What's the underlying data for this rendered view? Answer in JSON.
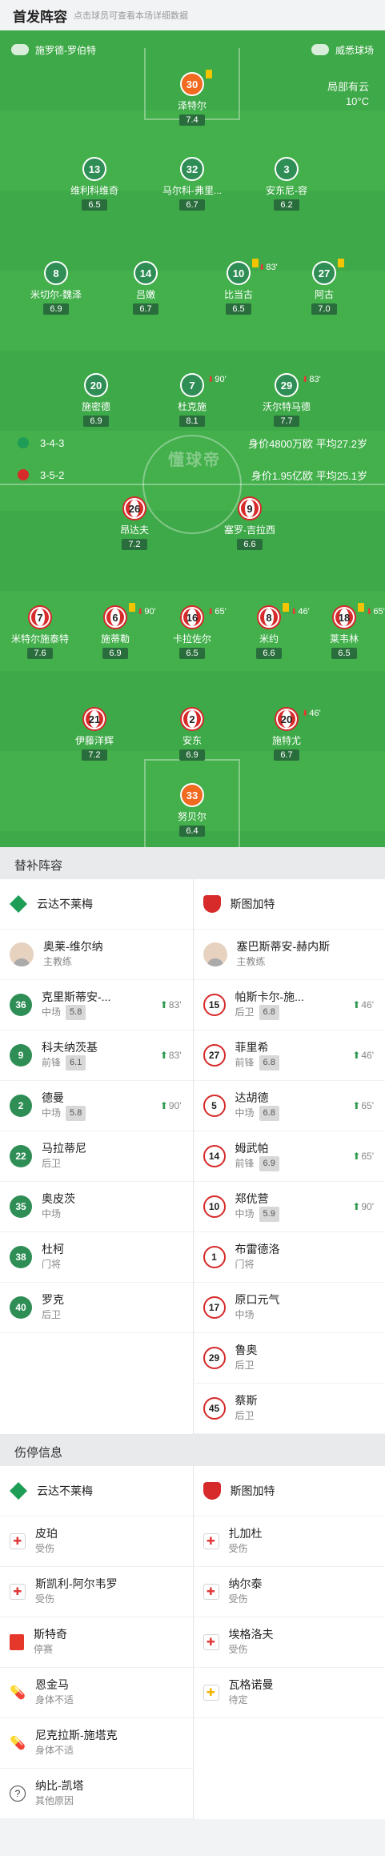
{
  "header": {
    "title": "首发阵容",
    "subtitle": "点击球员可查看本场详细数据"
  },
  "pitch_top": {
    "home_coach": "施罗德-罗伯特",
    "stadium": "威悉球场",
    "weather": "局部有云",
    "temp": "10°C",
    "watermark": "懂球帝"
  },
  "home_formation": {
    "formation": "3-4-3",
    "value": "身价4800万欧",
    "age": "平均27.2岁"
  },
  "away_formation": {
    "formation": "3-5-2",
    "value": "身价1.95亿欧",
    "age": "平均25.1岁"
  },
  "players": [
    {
      "num": "30",
      "name": "泽特尔",
      "rating": "7.4"
    },
    {
      "num": "13",
      "name": "维利科维奇",
      "rating": "6.5"
    },
    {
      "num": "32",
      "name": "马尔科-弗里...",
      "rating": "6.7"
    },
    {
      "num": "3",
      "name": "安东尼-容",
      "rating": "6.2"
    },
    {
      "num": "8",
      "name": "米切尔-魏泽",
      "rating": "6.9"
    },
    {
      "num": "14",
      "name": "吕嫩",
      "rating": "6.7"
    },
    {
      "num": "10",
      "name": "比当古",
      "rating": "6.5",
      "sub": "83'"
    },
    {
      "num": "27",
      "name": "阿古",
      "rating": "7.0"
    },
    {
      "num": "20",
      "name": "施密德",
      "rating": "6.9"
    },
    {
      "num": "7",
      "name": "杜克施",
      "rating": "8.1",
      "sub": "90'"
    },
    {
      "num": "29",
      "name": "沃尔特马德",
      "rating": "7.7",
      "sub": "83'"
    },
    {
      "num": "26",
      "name": "昂达夫",
      "rating": "7.2"
    },
    {
      "num": "9",
      "name": "塞罗-吉拉西",
      "rating": "6.6"
    },
    {
      "num": "7",
      "name": "米特尔施泰特",
      "rating": "7.6"
    },
    {
      "num": "6",
      "name": "施蒂勒",
      "rating": "6.9",
      "sub": "90'"
    },
    {
      "num": "16",
      "name": "卡拉佐尔",
      "rating": "6.5",
      "sub": "65'"
    },
    {
      "num": "8",
      "name": "米约",
      "rating": "6.6",
      "sub": "46'"
    },
    {
      "num": "18",
      "name": "莱韦林",
      "rating": "6.5",
      "sub": "65'"
    },
    {
      "num": "21",
      "name": "伊藤洋辉",
      "rating": "7.2"
    },
    {
      "num": "2",
      "name": "安东",
      "rating": "6.9"
    },
    {
      "num": "20",
      "name": "施特尤",
      "rating": "6.7",
      "sub": "46'"
    },
    {
      "num": "33",
      "name": "努贝尔",
      "rating": "6.4"
    }
  ],
  "subs": {
    "title": "替补阵容",
    "home_team": "云达不莱梅",
    "away_team": "斯图加特",
    "home_coach": {
      "name": "奥莱-维尔纳",
      "role": "主教练"
    },
    "away_coach": {
      "name": "塞巴斯蒂安-赫内斯",
      "role": "主教练"
    },
    "home": [
      {
        "num": "36",
        "name": "克里斯蒂安-...",
        "pos": "中场",
        "score": "5.8",
        "time": "83'"
      },
      {
        "num": "9",
        "name": "科夫纳茨基",
        "pos": "前锋",
        "score": "6.1",
        "time": "83'"
      },
      {
        "num": "2",
        "name": "德曼",
        "pos": "中场",
        "score": "5.8",
        "time": "90'"
      },
      {
        "num": "22",
        "name": "马拉蒂尼",
        "pos": "后卫"
      },
      {
        "num": "35",
        "name": "奥皮茨",
        "pos": "中场"
      },
      {
        "num": "38",
        "name": "杜柯",
        "pos": "门将"
      },
      {
        "num": "40",
        "name": "罗克",
        "pos": "后卫"
      }
    ],
    "away": [
      {
        "num": "15",
        "name": "帕斯卡尔-施...",
        "pos": "后卫",
        "score": "6.8",
        "time": "46'"
      },
      {
        "num": "27",
        "name": "菲里希",
        "pos": "前锋",
        "score": "6.8",
        "time": "46'"
      },
      {
        "num": "5",
        "name": "达胡德",
        "pos": "中场",
        "score": "6.8",
        "time": "65'"
      },
      {
        "num": "14",
        "name": "姆武帕",
        "pos": "前锋",
        "score": "6.9",
        "time": "65'"
      },
      {
        "num": "10",
        "name": "郑优营",
        "pos": "中场",
        "score": "5.9",
        "time": "90'"
      },
      {
        "num": "1",
        "name": "布雷德洛",
        "pos": "门将"
      },
      {
        "num": "17",
        "name": "原口元气",
        "pos": "中场"
      },
      {
        "num": "29",
        "name": "鲁奥",
        "pos": "后卫"
      },
      {
        "num": "45",
        "name": "蔡斯",
        "pos": "后卫"
      }
    ]
  },
  "injuries": {
    "title": "伤停信息",
    "home_team": "云达不莱梅",
    "away_team": "斯图加特",
    "home": [
      {
        "name": "皮珀",
        "status": "受伤",
        "icon": "medical-cross"
      },
      {
        "name": "斯凯利-阿尔韦罗",
        "status": "受伤",
        "icon": "medical-cross"
      },
      {
        "name": "斯特奇",
        "status": "停赛",
        "icon": "red-card"
      },
      {
        "name": "恩金马",
        "status": "身体不适",
        "icon": "pill"
      },
      {
        "name": "尼克拉斯-施塔克",
        "status": "身体不适",
        "icon": "pill"
      },
      {
        "name": "纳比-凯塔",
        "status": "其他原因",
        "icon": "question"
      }
    ],
    "away": [
      {
        "name": "扎加杜",
        "status": "受伤",
        "icon": "medical-cross"
      },
      {
        "name": "纳尔泰",
        "status": "受伤",
        "icon": "medical-cross"
      },
      {
        "name": "埃格洛夫",
        "status": "受伤",
        "icon": "medical-cross"
      },
      {
        "name": "瓦格诺曼",
        "status": "待定",
        "icon": "medical-cross-yellow"
      }
    ]
  }
}
